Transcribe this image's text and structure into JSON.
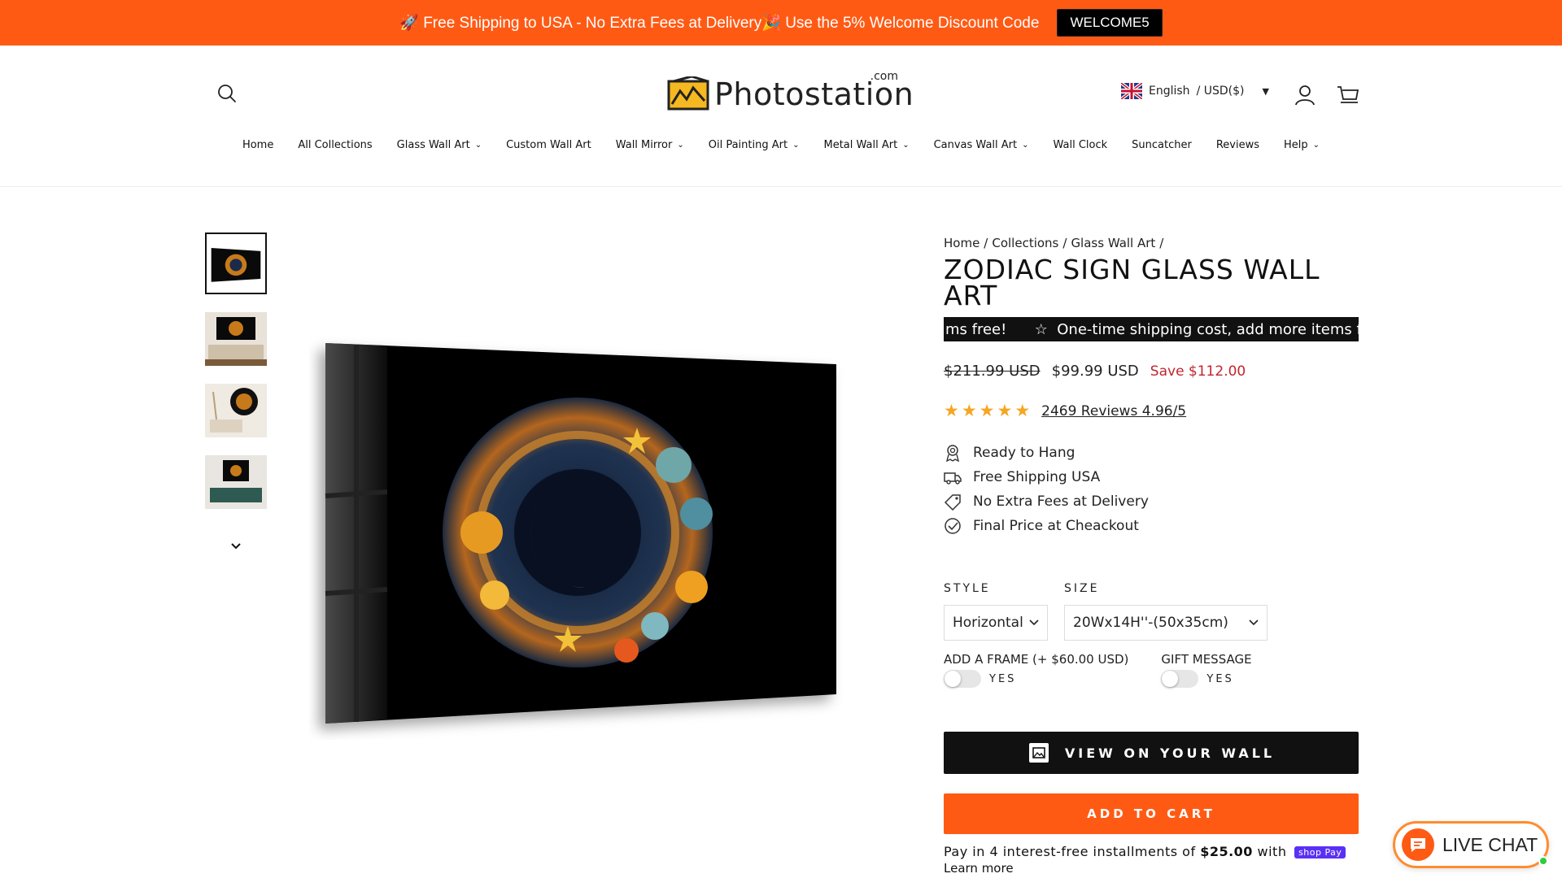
{
  "announcement": {
    "text": "🚀 Free Shipping to USA - No Extra Fees at Delivery🎉 Use the 5% Welcome Discount Code",
    "code": "WELCOME5"
  },
  "header": {
    "logo_word": "Photostation",
    "logo_suffix": ".com",
    "language": "English",
    "currency": "/ USD($)"
  },
  "nav": [
    {
      "label": "Home",
      "has_dropdown": false
    },
    {
      "label": "All Collections",
      "has_dropdown": false
    },
    {
      "label": "Glass Wall Art",
      "has_dropdown": true
    },
    {
      "label": "Custom Wall Art",
      "has_dropdown": false
    },
    {
      "label": "Wall Mirror",
      "has_dropdown": true
    },
    {
      "label": "Oil Painting Art",
      "has_dropdown": true
    },
    {
      "label": "Metal Wall Art",
      "has_dropdown": true
    },
    {
      "label": "Canvas Wall Art",
      "has_dropdown": true
    },
    {
      "label": "Wall Clock",
      "has_dropdown": false
    },
    {
      "label": "Suncatcher",
      "has_dropdown": false
    },
    {
      "label": "Reviews",
      "has_dropdown": false
    },
    {
      "label": "Help",
      "has_dropdown": true
    }
  ],
  "breadcrumb": [
    "Home",
    "Collections",
    "Glass Wall Art"
  ],
  "product": {
    "title": "ZODIAC SIGN GLASS WALL ART",
    "marquee_text": "ms free!      ☆  One-time shipping cost, add more items f",
    "price_old": "$211.99 USD",
    "price_new": "$99.99 USD",
    "price_save": "Save $112.00",
    "rating_stars": 5,
    "reviews": "2469 Reviews 4.96/5",
    "features": [
      {
        "icon": "ribbon-icon",
        "label": "Ready to Hang"
      },
      {
        "icon": "truck-icon",
        "label": "Free Shipping USA"
      },
      {
        "icon": "tag-icon",
        "label": "No Extra Fees at Delivery"
      },
      {
        "icon": "check-circle-icon",
        "label": "Final Price at Cheackout"
      }
    ],
    "style_label": "STYLE",
    "style_value": "Horizontal",
    "size_label": "SIZE",
    "size_value": "20Wx14H''-(50x35cm)",
    "frame_label": "ADD A FRAME (+ $60.00 USD)",
    "frame_toggle": "YES",
    "gift_label": "GIFT MESSAGE",
    "gift_toggle": "YES",
    "view_wall_label": "VIEW ON YOUR WALL",
    "add_to_cart_label": "ADD TO CART",
    "installments_pre": "Pay in 4 interest-free installments of ",
    "installments_amount": "$25.00",
    "installments_post": " with ",
    "shoppay": "shop Pay",
    "learn_more": "Learn more"
  },
  "livechat": {
    "label": "LIVE CHAT"
  },
  "colors": {
    "accent": "#ff5a14",
    "dark": "#111111",
    "sale": "#c0262d",
    "star": "#f5a623"
  }
}
